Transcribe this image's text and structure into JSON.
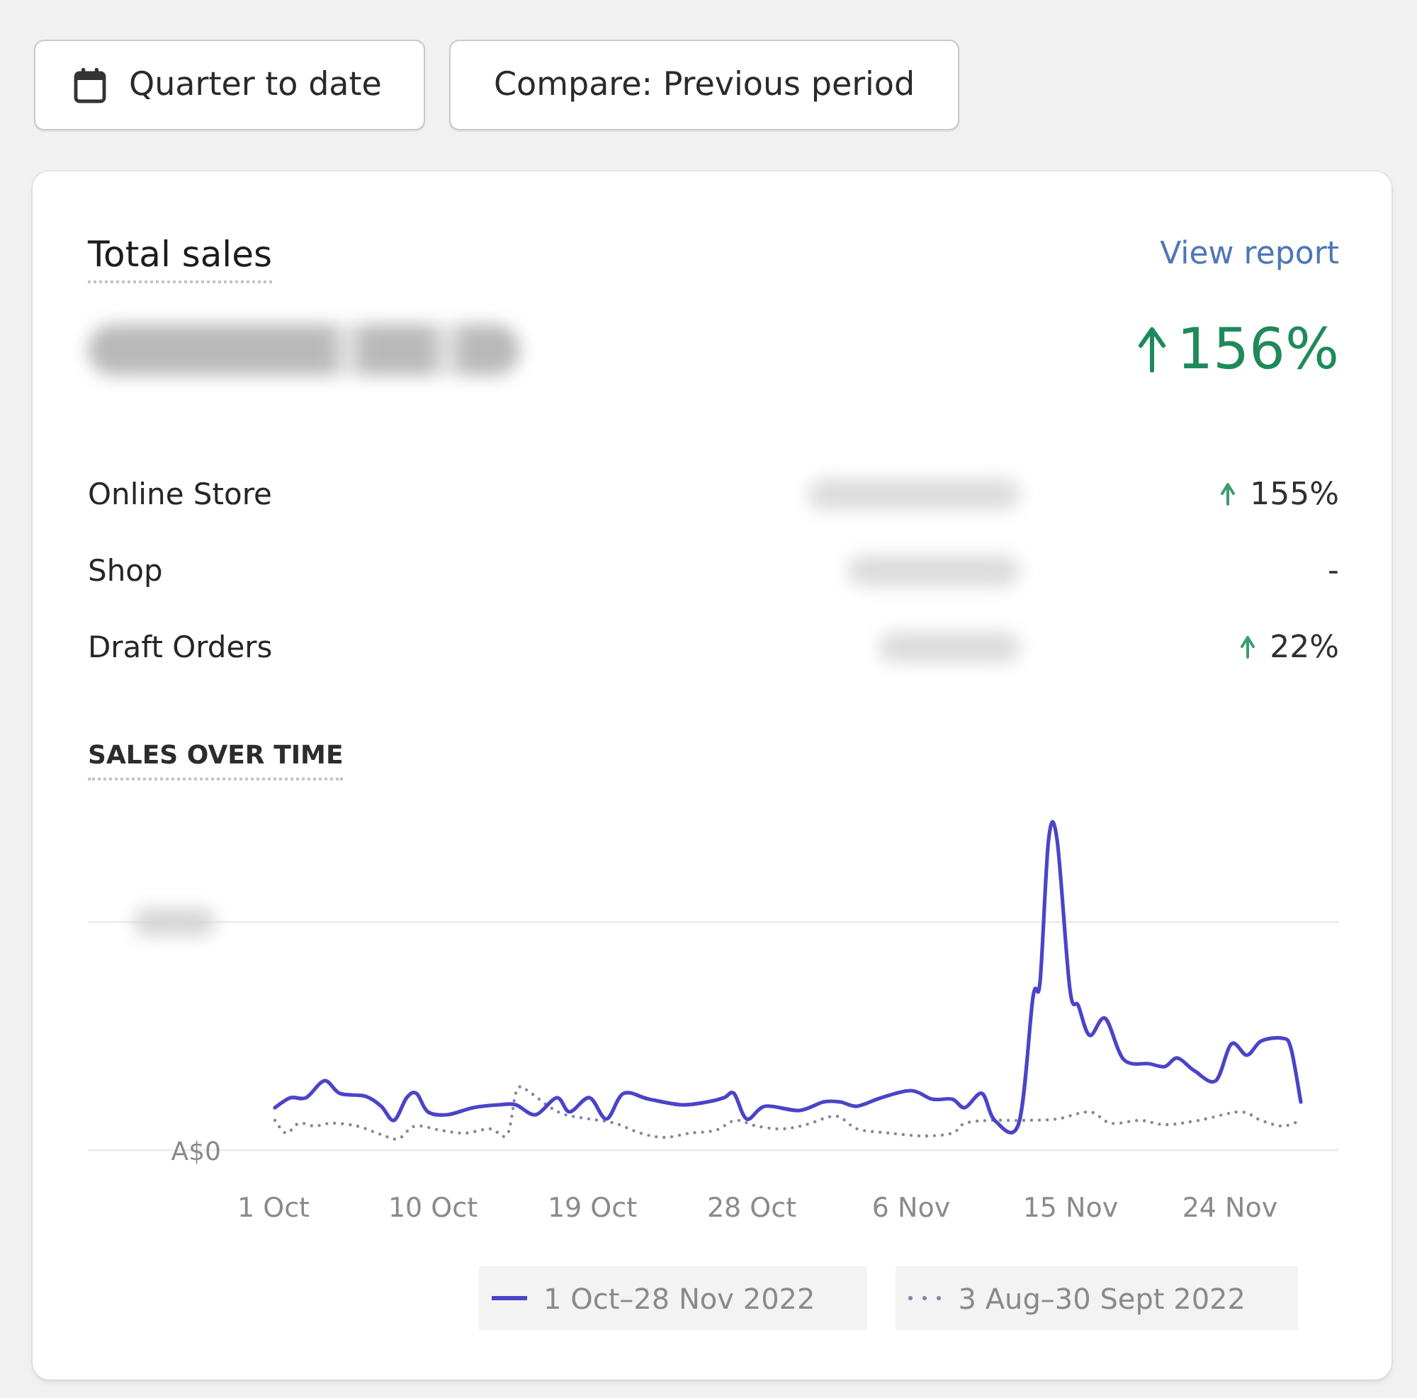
{
  "toolbar": {
    "buttons": [
      {
        "kind": "date_range",
        "label": "Quarter to date"
      },
      {
        "kind": "compare",
        "label": "Compare: Previous period"
      }
    ]
  },
  "total_sales": {
    "title": "Total sales",
    "link": "View report",
    "rising": true,
    "change": "156%"
  },
  "channels": [
    {
      "name": "Online Store",
      "rising": true,
      "change": "155%"
    },
    {
      "name": "Shop",
      "rising": false,
      "change": "-"
    },
    {
      "name": "Draft Orders",
      "rising": true,
      "change": "22%"
    }
  ],
  "sales_over_time": {
    "title": "SALES OVER TIME",
    "y_label": "A$0",
    "x_labels": [
      "1 Oct",
      "10 Oct",
      "19 Oct",
      "28 Oct",
      "6 Nov",
      "15 Nov",
      "24 Nov"
    ],
    "legend": [
      {
        "kind": "solid",
        "color": "#4b44c8",
        "label": "1 Oct–28 Nov 2022"
      },
      {
        "kind": "dotted",
        "color": "#7f88a0",
        "label": "3 Aug–30 Sept 2022"
      }
    ]
  }
}
